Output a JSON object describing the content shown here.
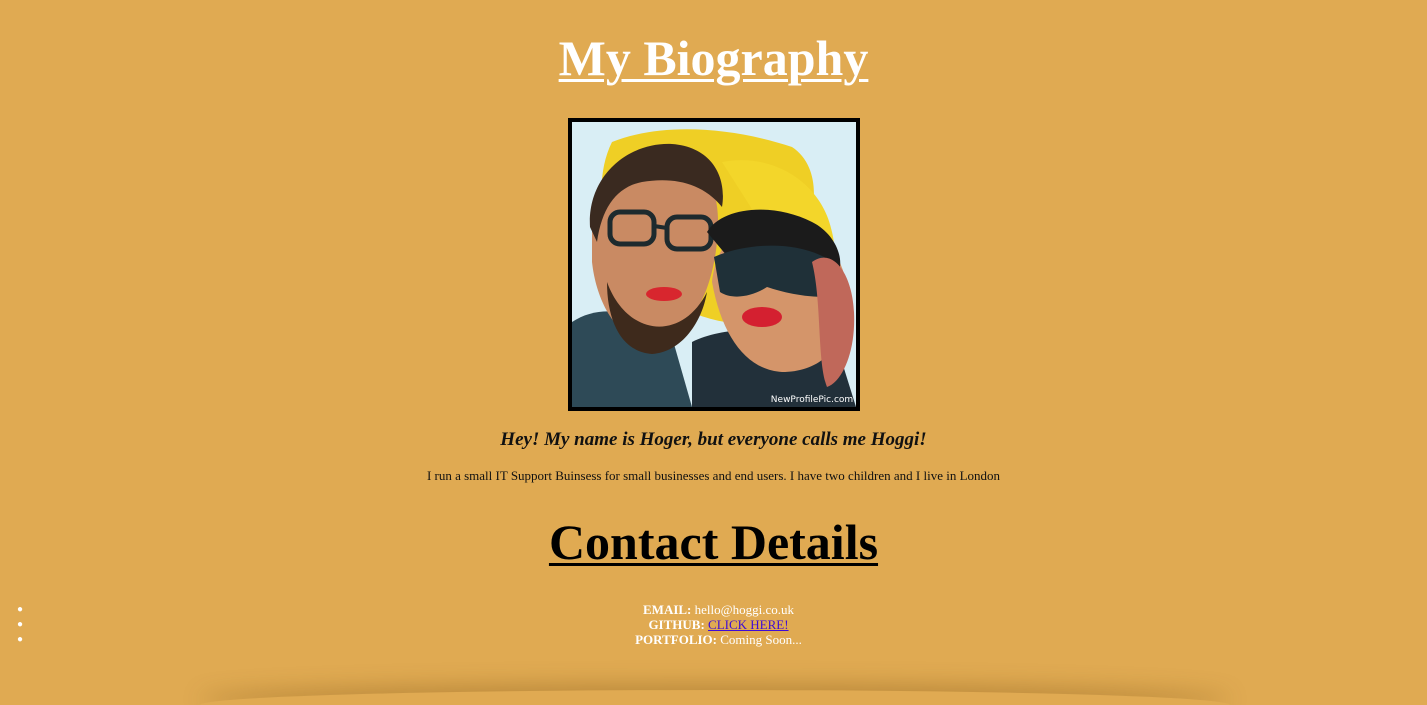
{
  "header": {
    "title": "My Biography"
  },
  "profile_image": {
    "watermark": "NewProfilePic.com"
  },
  "intro": {
    "tagline": "Hey! My name is Hoger, but everyone calls me Hoggi!",
    "about": "I run a small IT Support Buinsess for small businesses and end users. I have two children and I live in London"
  },
  "contact": {
    "title": "Contact Details",
    "items": [
      {
        "label": "EMAIL:",
        "value": "hello@hoggi.co.uk"
      },
      {
        "label": "GITHUB:",
        "value": "CLICK HERE!"
      },
      {
        "label": "PORTFOLIO:",
        "value": "Coming Soon..."
      }
    ]
  },
  "colors": {
    "background": "#e0aa52",
    "heading": "#ffffff",
    "link": "#3d0bd6"
  }
}
